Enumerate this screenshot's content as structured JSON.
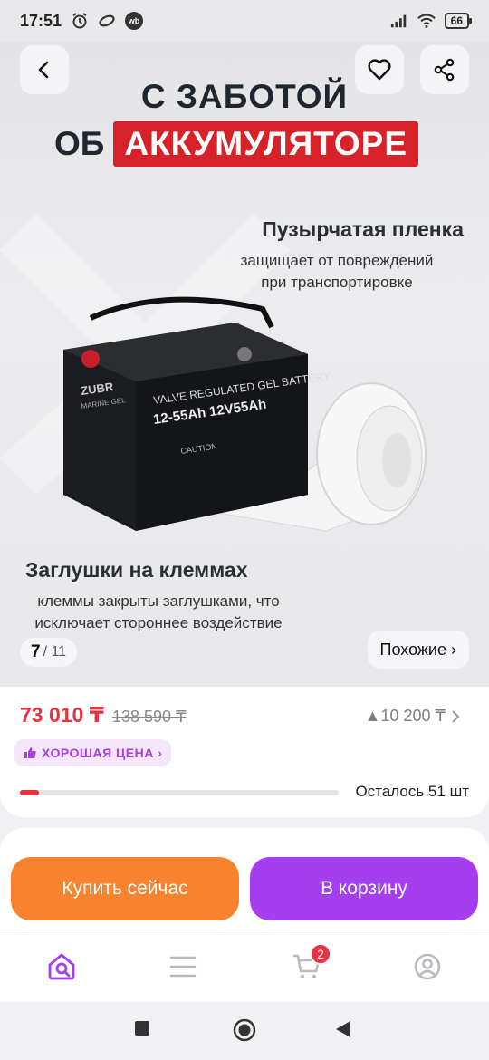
{
  "status_bar": {
    "time": "17:51",
    "wb_label": "wb",
    "battery_level": "66"
  },
  "hero": {
    "title_line1": "С ЗАБОТОЙ",
    "title_line2_prefix": "ОБ",
    "title_line2_highlight": "АККУМУЛЯТОРЕ",
    "caption_a_title": "Пузырчатая пленка",
    "caption_a_text": "защищает от повреждений при транспортировке",
    "caption_b_title": "Заглушки на клеммах",
    "caption_b_text": "клеммы закрыты заглушками, что исключает стороннее воздействие",
    "battery_brand": "ZUBR",
    "battery_sub": "MARINE GEL",
    "battery_label_1": "VALVE REGULATED GEL BATTERY",
    "battery_label_2": "12-55Ah 12V55Ah",
    "battery_caution": "CAUTION",
    "image_index": "7",
    "image_total": "/ 11",
    "similar_label": "Похожие ›"
  },
  "price": {
    "current": "73 010 ₸",
    "old": "138 590 ₸",
    "delta": "▲10 200 ₸",
    "good_price_label": "ХОРОШАЯ ЦЕНА ›",
    "stock_fraction": 0.06,
    "stock_text": "Осталось 51 шт"
  },
  "actions": {
    "buy_now": "Купить сейчас",
    "to_cart": "В корзину"
  },
  "tab_bar": {
    "cart_count": "2",
    "active_color": "#a43ef0"
  },
  "colors": {
    "accent_red": "#e5333f",
    "buy_orange": "#f9822e",
    "cart_purple": "#a43ef0"
  }
}
